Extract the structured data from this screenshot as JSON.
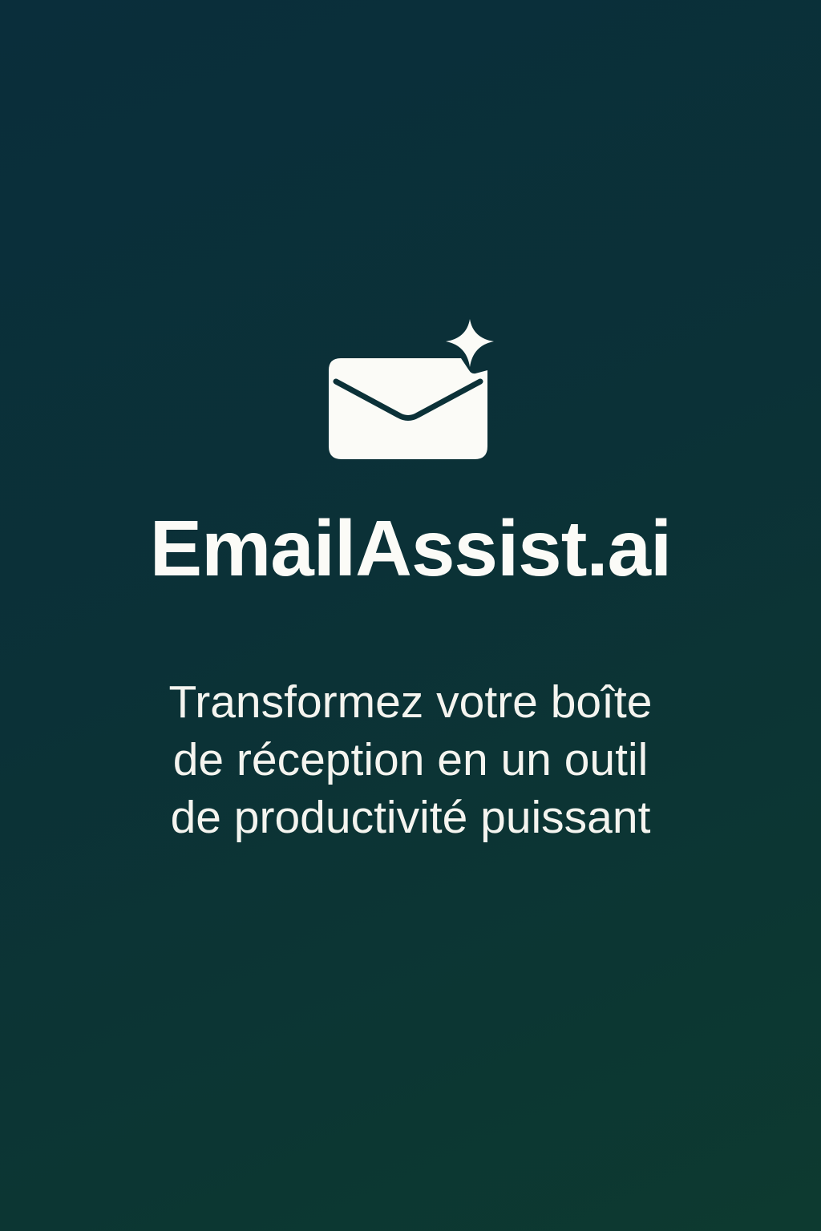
{
  "splash": {
    "logo_icon": "envelope-sparkle-icon",
    "app_name": "EmailAssist.ai",
    "tagline_lines": [
      "Transformez votre boîte",
      "de réception en un outil",
      "de productivité puissant"
    ]
  },
  "colors": {
    "background_start": "#0a2e3b",
    "background_end": "#0d3a30",
    "foreground": "#fbfbf7"
  }
}
